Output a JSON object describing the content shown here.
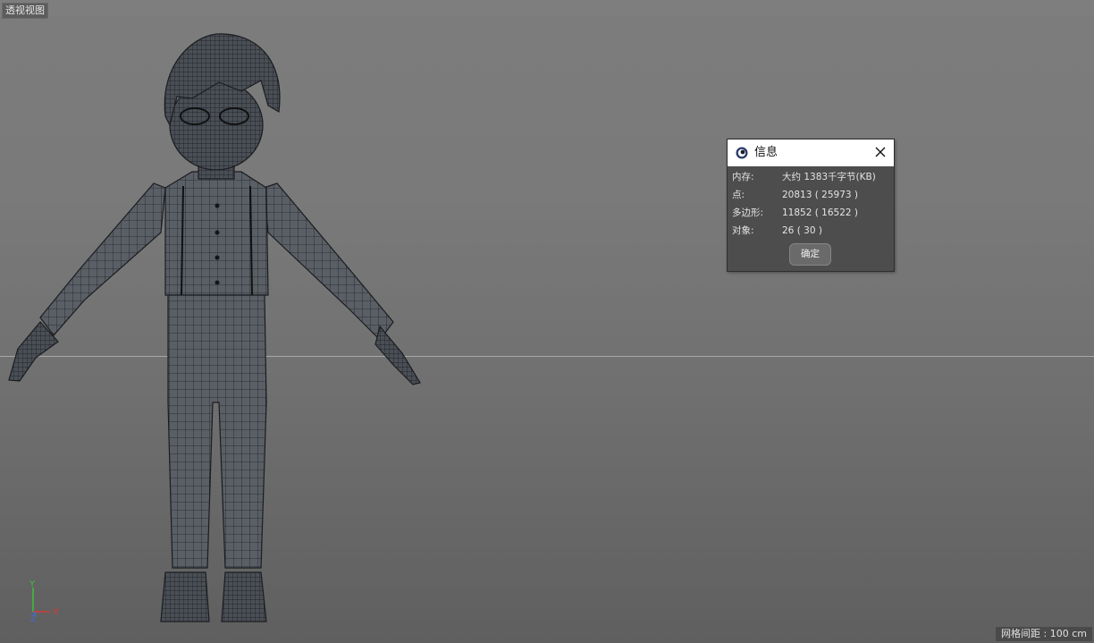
{
  "viewport": {
    "label": "透视视图",
    "grid_spacing": "网格间距 : 100 cm"
  },
  "axis": {
    "y": "Y",
    "z": "Z",
    "x": "X"
  },
  "dialog": {
    "title": "信息",
    "rows": [
      {
        "key": "内存:",
        "value": "大约 1383千字节(KB)"
      },
      {
        "key": "点:",
        "value": "20813 ( 25973 )"
      },
      {
        "key": "多边形:",
        "value": "11852 ( 16522 )"
      },
      {
        "key": "对象:",
        "value": "26 ( 30 )"
      }
    ],
    "ok_label": "确定"
  },
  "colors": {
    "axis_y": "#3fbf3f",
    "axis_x": "#d23c3c",
    "axis_z": "#3f6fd2"
  }
}
